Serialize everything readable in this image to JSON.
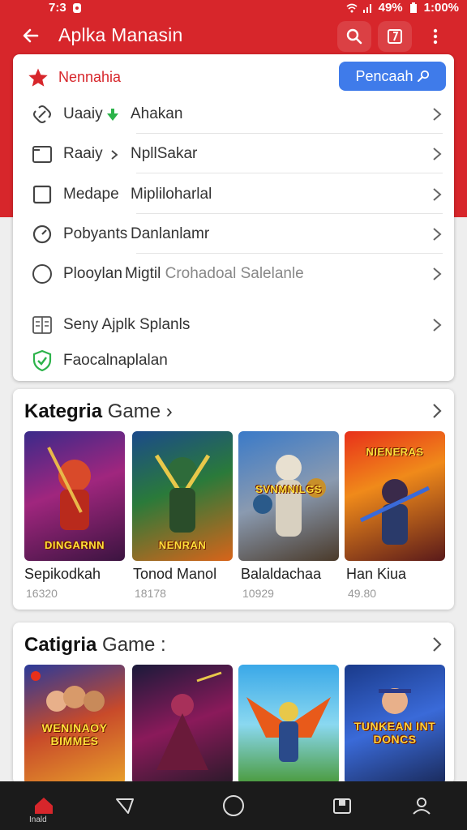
{
  "status_bar": {
    "time_left": "7:3",
    "battery": "49%",
    "time": "1:00%"
  },
  "app_bar": {
    "title": "Aplka Manasin",
    "icons": [
      "back-arrow-icon",
      "search-icon",
      "bookmark-icon",
      "more-vert-icon"
    ]
  },
  "menu": {
    "favorite_label": "Nennahia",
    "search_button": "Pencaah",
    "rows": [
      {
        "label": "Uaaiy",
        "sub": "Ahakan",
        "icon": "link-icon"
      },
      {
        "label": "Raaiy",
        "sub": "NpllSakar",
        "icon": "square-icon"
      },
      {
        "label": "Medape",
        "sub": "Mipliloharlal",
        "icon": "square-icon"
      },
      {
        "label": "Pobyants",
        "sub": "Danlanlamr",
        "icon": "clock-icon"
      },
      {
        "label": "Plooylan",
        "sub": "Migtil",
        "sub_light": "Crohadoal Salelanle",
        "icon": "circle-icon"
      },
      {
        "label": "Seny Ajplk Splanls",
        "icon": "document-icon"
      },
      {
        "label": "Faocalnaplalan",
        "icon": "shield-check-icon"
      }
    ]
  },
  "section1": {
    "title_bold": "Kategria",
    "title_light": "Game ›",
    "games": [
      {
        "name": "Sepikodkah",
        "count": "16320",
        "cover_text": "DINGARNN"
      },
      {
        "name": "Tonod Manol",
        "count": "18178",
        "cover_text": "NENRAN"
      },
      {
        "name": "Balaldachaa",
        "count": "10929",
        "cover_text": "SVNMNILGS"
      },
      {
        "name": "Han Kiua",
        "count": "49.80",
        "cover_text": "NIENERAS"
      }
    ]
  },
  "section2": {
    "title_bold": "Catigria",
    "title_light": "Game :",
    "games": [
      {
        "cover_text": "WENINAOY BIMMES"
      },
      {
        "cover_text": ""
      },
      {
        "cover_text": ""
      },
      {
        "cover_text": "TUNKEAN INT DONCS"
      }
    ]
  },
  "bottom_nav": {
    "home_label": "Inald",
    "items": [
      "home-icon",
      "back-triangle-icon",
      "home-circle-icon",
      "recent-icon",
      "profile-icon"
    ]
  },
  "colors": {
    "brand_red": "#d7262b",
    "search_blue": "#3f7bea",
    "nav_dark": "#1b1b1b"
  }
}
